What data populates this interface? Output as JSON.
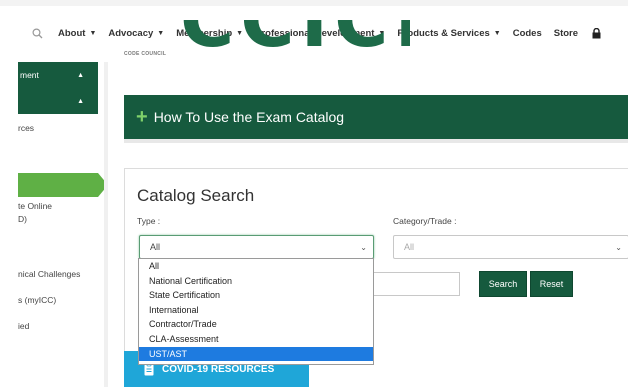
{
  "nav": {
    "items": [
      {
        "label": "About",
        "caret": true
      },
      {
        "label": "Advocacy",
        "caret": true
      },
      {
        "label": "Membership",
        "caret": true
      },
      {
        "label": "Professional Development",
        "caret": true
      },
      {
        "label": "Products & Services",
        "caret": true
      },
      {
        "label": "Codes",
        "caret": false
      },
      {
        "label": "Store",
        "caret": false
      }
    ],
    "search_icon": "search-icon",
    "lock_icon": "lock-icon"
  },
  "logo": {
    "sub": "CODE COUNCIL",
    "big": "CCICI"
  },
  "sidebar": {
    "menu_rows": [
      "ment",
      ""
    ],
    "links": [
      "rces",
      "te Online",
      "D)",
      "nical Challenges",
      "s (myICC)",
      "ied"
    ]
  },
  "accordion": {
    "plus": "+",
    "title": "How To Use the Exam Catalog"
  },
  "search": {
    "title": "Catalog Search",
    "type_label": "Type :",
    "category_label": "Category/Trade :",
    "type_value": "All",
    "category_value": "All",
    "search_button": "Search",
    "reset_button": "Reset"
  },
  "dropdown": {
    "options": [
      "All",
      "National Certification",
      "State Certification",
      "International",
      "Contractor/Trade",
      "CLA-Assessment",
      "UST/AST"
    ],
    "selected": "UST/AST"
  },
  "covid": {
    "label": "COVID-19 RESOURCES"
  },
  "colors": {
    "brand_green": "#165a3e",
    "accent_green": "#5fb045",
    "covid_blue": "#1fa6d8",
    "selected_blue": "#1e7be0"
  }
}
